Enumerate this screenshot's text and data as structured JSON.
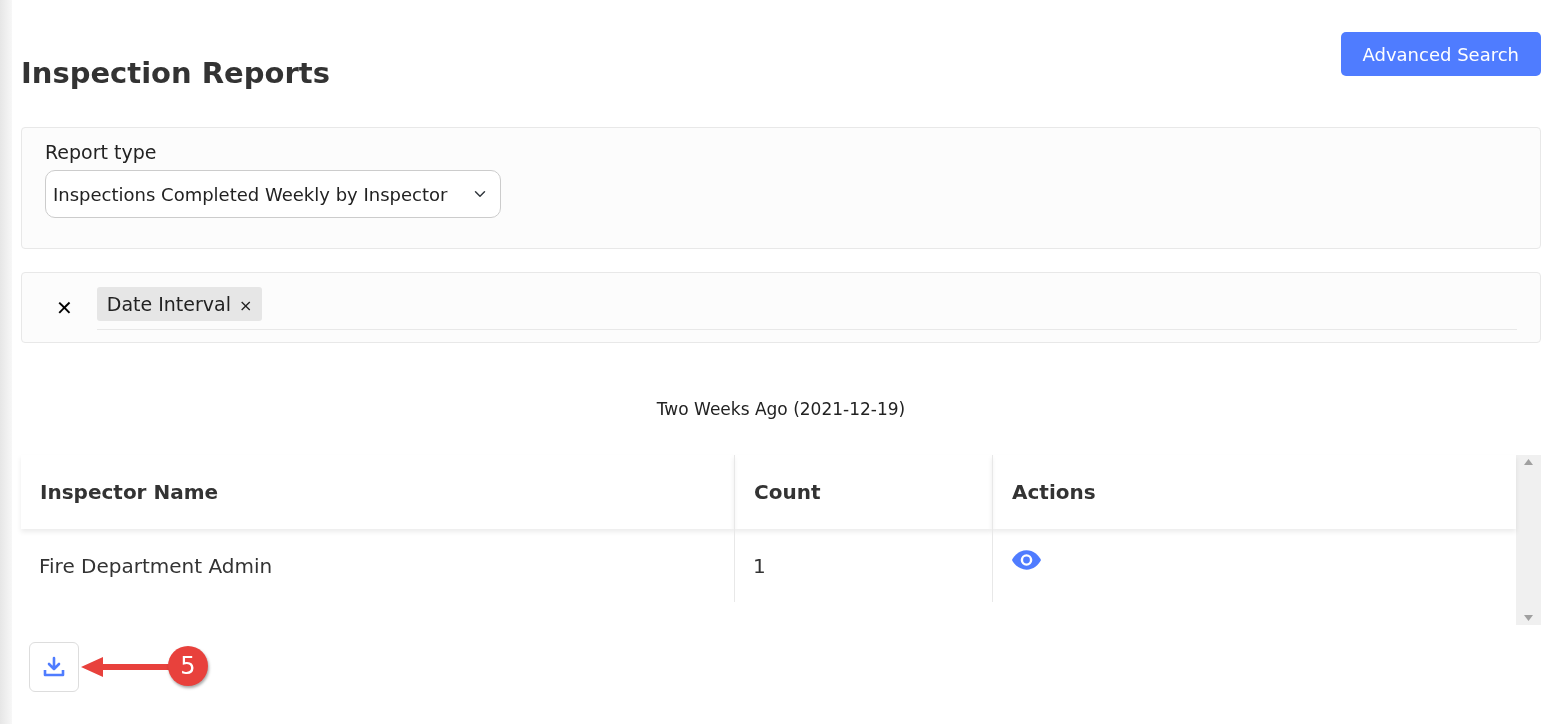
{
  "page": {
    "title": "Inspection Reports",
    "advanced_search_button": "Advanced Search"
  },
  "report_type": {
    "label": "Report type",
    "value": "Inspections Completed Weekly by Inspector"
  },
  "filters": {
    "clear_icon": "✕",
    "chips": [
      {
        "label": "Date Interval",
        "remove": "×"
      }
    ]
  },
  "table": {
    "caption": "Two Weeks Ago (2021-12-19)",
    "columns": [
      "Inspector Name",
      "Count",
      "Actions"
    ],
    "rows": [
      {
        "inspector_name": "Fire Department Admin",
        "count": "1"
      }
    ]
  },
  "callout": {
    "number": "5"
  }
}
